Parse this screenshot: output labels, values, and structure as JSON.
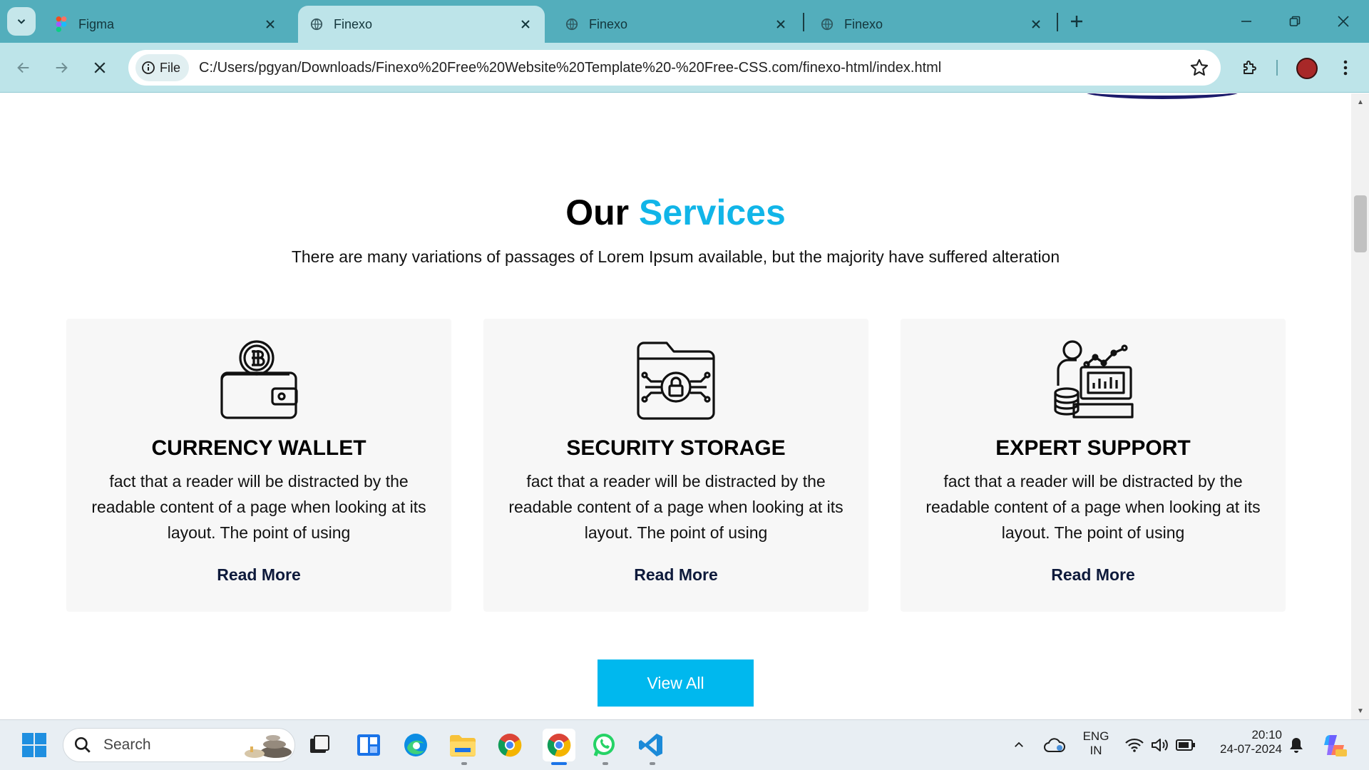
{
  "browser": {
    "tabs": [
      {
        "title": "Figma",
        "active": false
      },
      {
        "title": "Finexo",
        "active": true
      },
      {
        "title": "Finexo",
        "active": false
      },
      {
        "title": "Finexo",
        "active": false
      }
    ],
    "site_chip": "File",
    "url": "C:/Users/pgyan/Downloads/Finexo%20Free%20Website%20Template%20-%20Free-CSS.com/finexo-html/index.html"
  },
  "page": {
    "title_main": "Our",
    "title_accent": "Services",
    "subtitle": "There are many variations of passages of Lorem Ipsum available, but the majority have suffered alteration",
    "accent_color": "#11b5e8",
    "services": [
      {
        "title": "CURRENCY WALLET",
        "icon": "bitcoin-wallet-icon",
        "text": "fact that a reader will be distracted by the readable content of a page when looking at its layout. The point of using",
        "link": "Read More"
      },
      {
        "title": "SECURITY STORAGE",
        "icon": "secure-folder-icon",
        "text": "fact that a reader will be distracted by the readable content of a page when looking at its layout. The point of using",
        "link": "Read More"
      },
      {
        "title": "EXPERT SUPPORT",
        "icon": "expert-analytics-icon",
        "text": "fact that a reader will be distracted by the readable content of a page when looking at its layout. The point of using",
        "link": "Read More"
      }
    ],
    "view_all": "View All",
    "button_color": "#00b8ee"
  },
  "taskbar": {
    "search_placeholder": "Search",
    "lang_top": "ENG",
    "lang_bottom": "IN",
    "time": "20:10",
    "date": "24-07-2024"
  }
}
